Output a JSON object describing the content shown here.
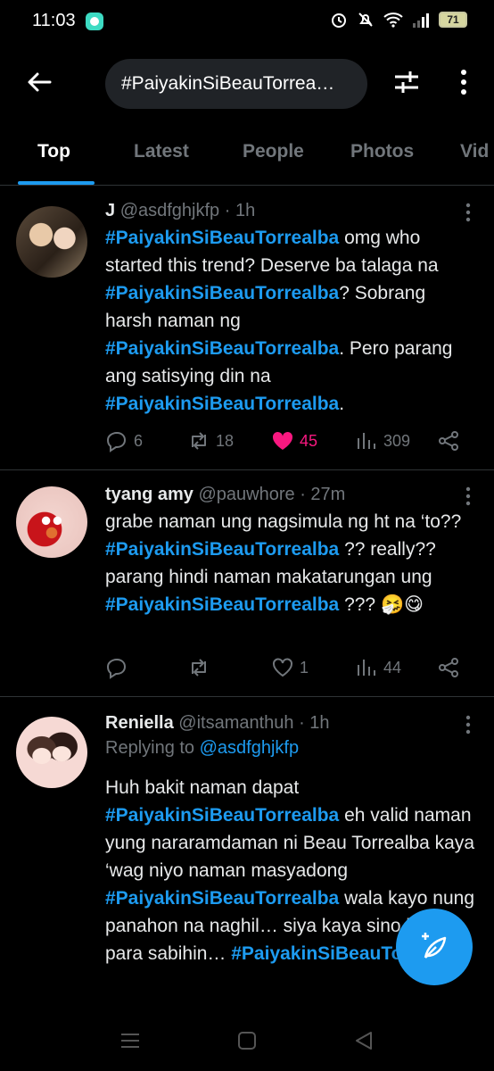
{
  "status_bar": {
    "time": "11:03",
    "battery": "71"
  },
  "header": {
    "search_query": "#PaiyakinSiBeauTorrea…"
  },
  "tabs": [
    {
      "label": "Top",
      "active": true
    },
    {
      "label": "Latest",
      "active": false
    },
    {
      "label": "People",
      "active": false
    },
    {
      "label": "Photos",
      "active": false
    },
    {
      "label": "Vid",
      "active": false
    }
  ],
  "tweets": [
    {
      "name": "J",
      "handle": "@asdfghjkfp",
      "time": "· 1h",
      "segments": [
        {
          "type": "hashtag",
          "text": "#PaiyakinSiBeauTorrealba"
        },
        {
          "type": "text",
          "text": " omg who started this trend? Deserve ba talaga na "
        },
        {
          "type": "hashtag",
          "text": "#PaiyakinSiBeauTorrealba"
        },
        {
          "type": "text",
          "text": "? Sobrang harsh naman ng "
        },
        {
          "type": "hashtag",
          "text": "#PaiyakinSiBeauTorrealba"
        },
        {
          "type": "text",
          "text": ". Pero parang ang satisying din na "
        },
        {
          "type": "hashtag",
          "text": "#PaiyakinSiBeauTorrealba"
        },
        {
          "type": "text",
          "text": "."
        }
      ],
      "replies": "6",
      "retweets": "18",
      "likes": "45",
      "liked": true,
      "views": "309"
    },
    {
      "name": "tyang amy",
      "handle": "@pauwhore",
      "time": "· 27m",
      "segments": [
        {
          "type": "text",
          "text": "grabe naman ung nagsimula ng ht na ‘to?? "
        },
        {
          "type": "hashtag",
          "text": "#PaiyakinSiBeauTorrealba"
        },
        {
          "type": "text",
          "text": " ?? really?? parang hindi naman makatarungan ung "
        },
        {
          "type": "hashtag",
          "text": "#PaiyakinSiBeauTorrealba"
        },
        {
          "type": "text",
          "text": " ??? 🤧😋"
        }
      ],
      "replies": "",
      "retweets": "",
      "likes": "1",
      "liked": false,
      "views": "44"
    },
    {
      "name": "Reniella",
      "handle": "@itsamanthuh",
      "time": "· 1h",
      "replying_label": "Replying to ",
      "replying_to": "@asdfghjkfp",
      "segments": [
        {
          "type": "text",
          "text": "Huh bakit naman dapat "
        },
        {
          "type": "hashtag",
          "text": "#PaiyakinSiBeauTorrealba"
        },
        {
          "type": "text",
          "text": " eh valid naman yung nararamdaman ni Beau Torrealba kaya ‘wag niyo naman masyadong "
        },
        {
          "type": "hashtag",
          "text": "#PaiyakinSiBeauTorrealba"
        },
        {
          "type": "text",
          "text": " wala kayo nung panahon na naghil… siya kaya sino kayo para sabihin… "
        },
        {
          "type": "hashtag",
          "text": "#PaiyakinSiBeauTorrealba"
        }
      ]
    }
  ],
  "colors": {
    "accent": "#1d9bf0",
    "like": "#f91880",
    "muted": "#71767b",
    "divider": "#2f3336"
  }
}
